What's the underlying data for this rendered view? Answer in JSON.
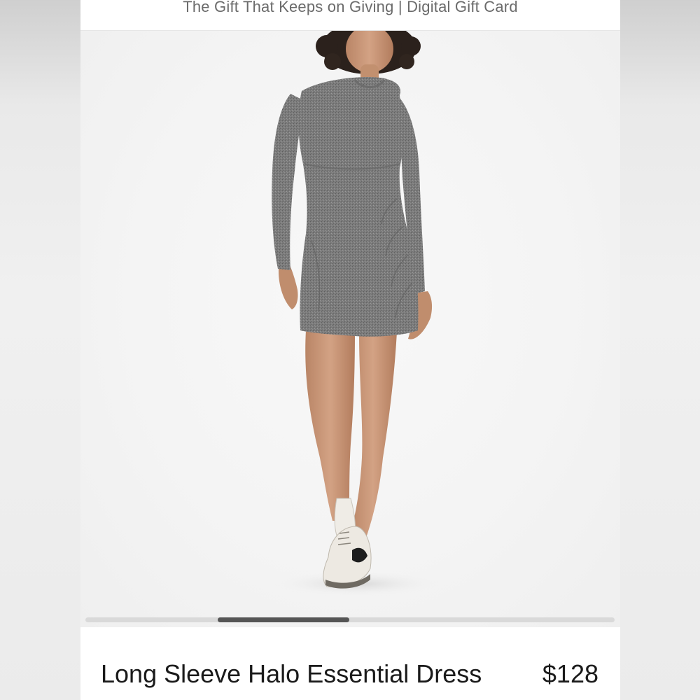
{
  "banner": {
    "text": "The Gift That Keeps on Giving | Digital Gift Card"
  },
  "product": {
    "name": "Long Sleeve Halo Essential Dress",
    "price": "$128",
    "image_description_icon": "product-photo"
  },
  "gallery": {
    "current_image_index": 2,
    "image_count": 4
  },
  "colors": {
    "text_primary": "#1a1a1a",
    "banner_text": "#6b6b6b",
    "scroll_thumb": "#555555",
    "scroll_track": "#d9d9d9",
    "dress": "#7d7d7d"
  }
}
